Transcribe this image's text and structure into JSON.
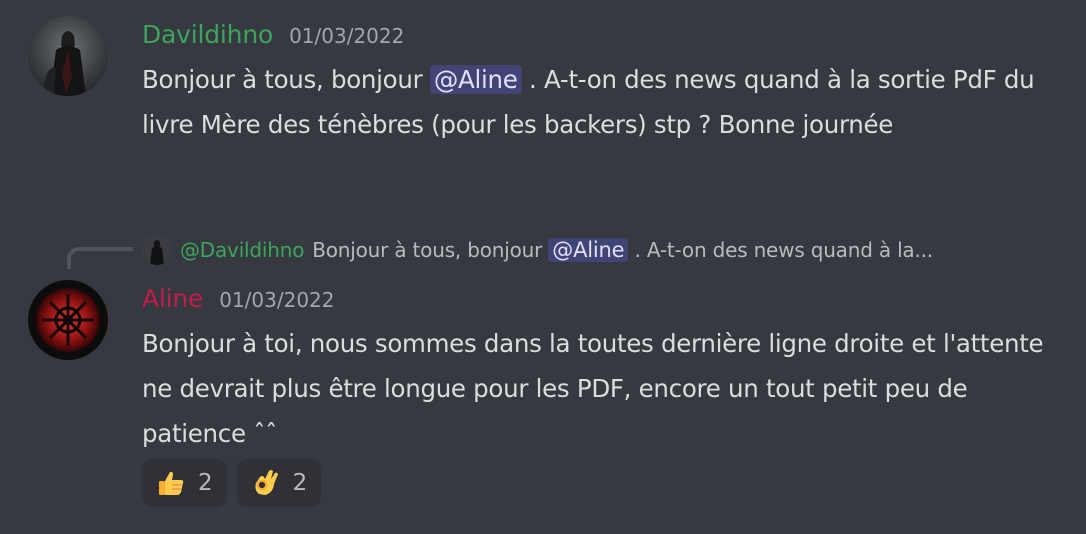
{
  "colors": {
    "background": "#36393f",
    "author1": "#3ba55c",
    "author2": "#c11c4a",
    "text": "#dcddde",
    "muted": "#a3a6aa",
    "mention_bg": "#454a7a",
    "reaction_bg": "#2f3136"
  },
  "messages": [
    {
      "author": "Davildihno",
      "timestamp": "01/03/2022",
      "text_before_mention": "Bonjour à tous, bonjour ",
      "mention": "@Aline",
      "text_after_mention": " . A-t-on des news quand à la sortie PdF du livre Mère des ténèbres (pour les backers) stp ? Bonne journée"
    },
    {
      "author": "Aline",
      "timestamp": "01/03/2022",
      "reply": {
        "author": "@Davildihno",
        "text_before_mention": "Bonjour à tous, bonjour ",
        "mention": "@Aline",
        "text_after_mention": " . A-t-on des news quand à la..."
      },
      "text": "Bonjour à toi, nous sommes dans la toutes dernière ligne droite et l'attente ne devrait plus être longue pour les PDF, encore un tout petit peu de patience ˆˆ",
      "reactions": [
        {
          "emoji": "thumbs-up",
          "count": "2"
        },
        {
          "emoji": "ok-hand",
          "count": "2"
        }
      ]
    }
  ]
}
